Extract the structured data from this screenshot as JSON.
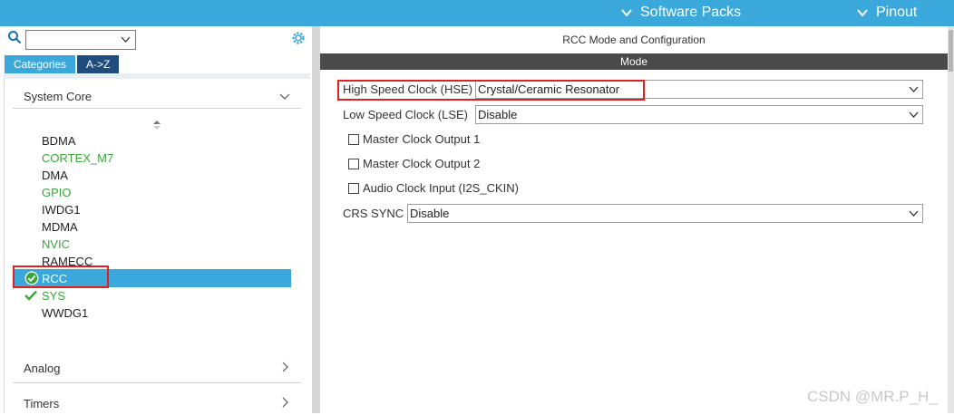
{
  "topbar": {
    "software_packs": "Software Packs",
    "pinout": "Pinout"
  },
  "left": {
    "tabs": {
      "categories": "Categories",
      "az": "A->Z"
    },
    "system_core": "System Core",
    "peripherals": [
      {
        "name": "BDMA",
        "color": "dark"
      },
      {
        "name": "CORTEX_M7",
        "color": "green"
      },
      {
        "name": "DMA",
        "color": "dark"
      },
      {
        "name": "GPIO",
        "color": "green"
      },
      {
        "name": "IWDG1",
        "color": "dark"
      },
      {
        "name": "MDMA",
        "color": "dark"
      },
      {
        "name": "NVIC",
        "color": "green"
      },
      {
        "name": "RAMECC",
        "color": "dark"
      },
      {
        "name": "RCC",
        "color": "selected"
      },
      {
        "name": "SYS",
        "color": "green"
      },
      {
        "name": "WWDG1",
        "color": "dark"
      }
    ],
    "analog": "Analog",
    "timers": "Timers"
  },
  "right": {
    "title": "RCC Mode and Configuration",
    "mode_header": "Mode",
    "hse": {
      "label": "High Speed Clock (HSE)",
      "value": "Crystal/Ceramic Resonator"
    },
    "lse": {
      "label": "Low Speed Clock (LSE)",
      "value": "Disable"
    },
    "checkboxes": [
      "Master Clock Output 1",
      "Master Clock Output 2",
      "Audio Clock Input (I2S_CKIN)"
    ],
    "crs": {
      "label": "CRS SYNC",
      "value": "Disable"
    }
  },
  "watermark": "CSDN @MR.P_H_",
  "colors": {
    "accent": "#3ba8dc",
    "dark_tab": "#1f4c7c",
    "green": "#3aa63a",
    "highlight": "#e02020",
    "mode_bar": "#4a4a4a"
  }
}
